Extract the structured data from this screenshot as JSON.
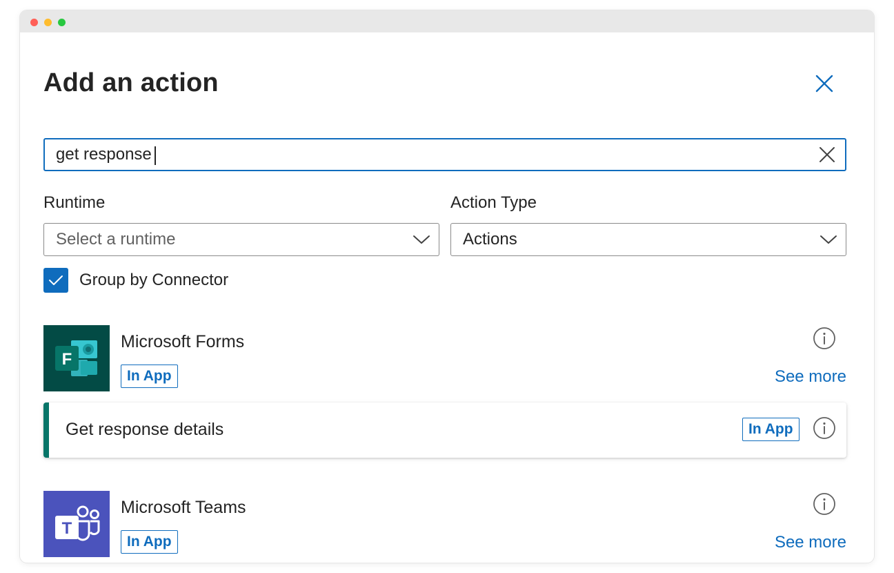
{
  "panel": {
    "title": "Add an action"
  },
  "search": {
    "value": "get response",
    "placeholder": ""
  },
  "filters": {
    "runtime_label": "Runtime",
    "runtime_placeholder": "Select a runtime",
    "action_type_label": "Action Type",
    "action_type_value": "Actions"
  },
  "group_by": {
    "label": "Group by Connector",
    "checked": true
  },
  "connectors": [
    {
      "name": "Microsoft Forms",
      "badge": "In App",
      "see_more": "See more",
      "icon": "microsoft-forms-icon",
      "color": "#034b45",
      "actions": [
        {
          "label": "Get response details",
          "badge": "In App"
        }
      ]
    },
    {
      "name": "Microsoft Teams",
      "badge": "In App",
      "see_more": "See more",
      "icon": "microsoft-teams-icon",
      "color": "#4b53bc"
    }
  ],
  "colors": {
    "accent": "#0f6cbd",
    "forms_accent": "#077568"
  }
}
